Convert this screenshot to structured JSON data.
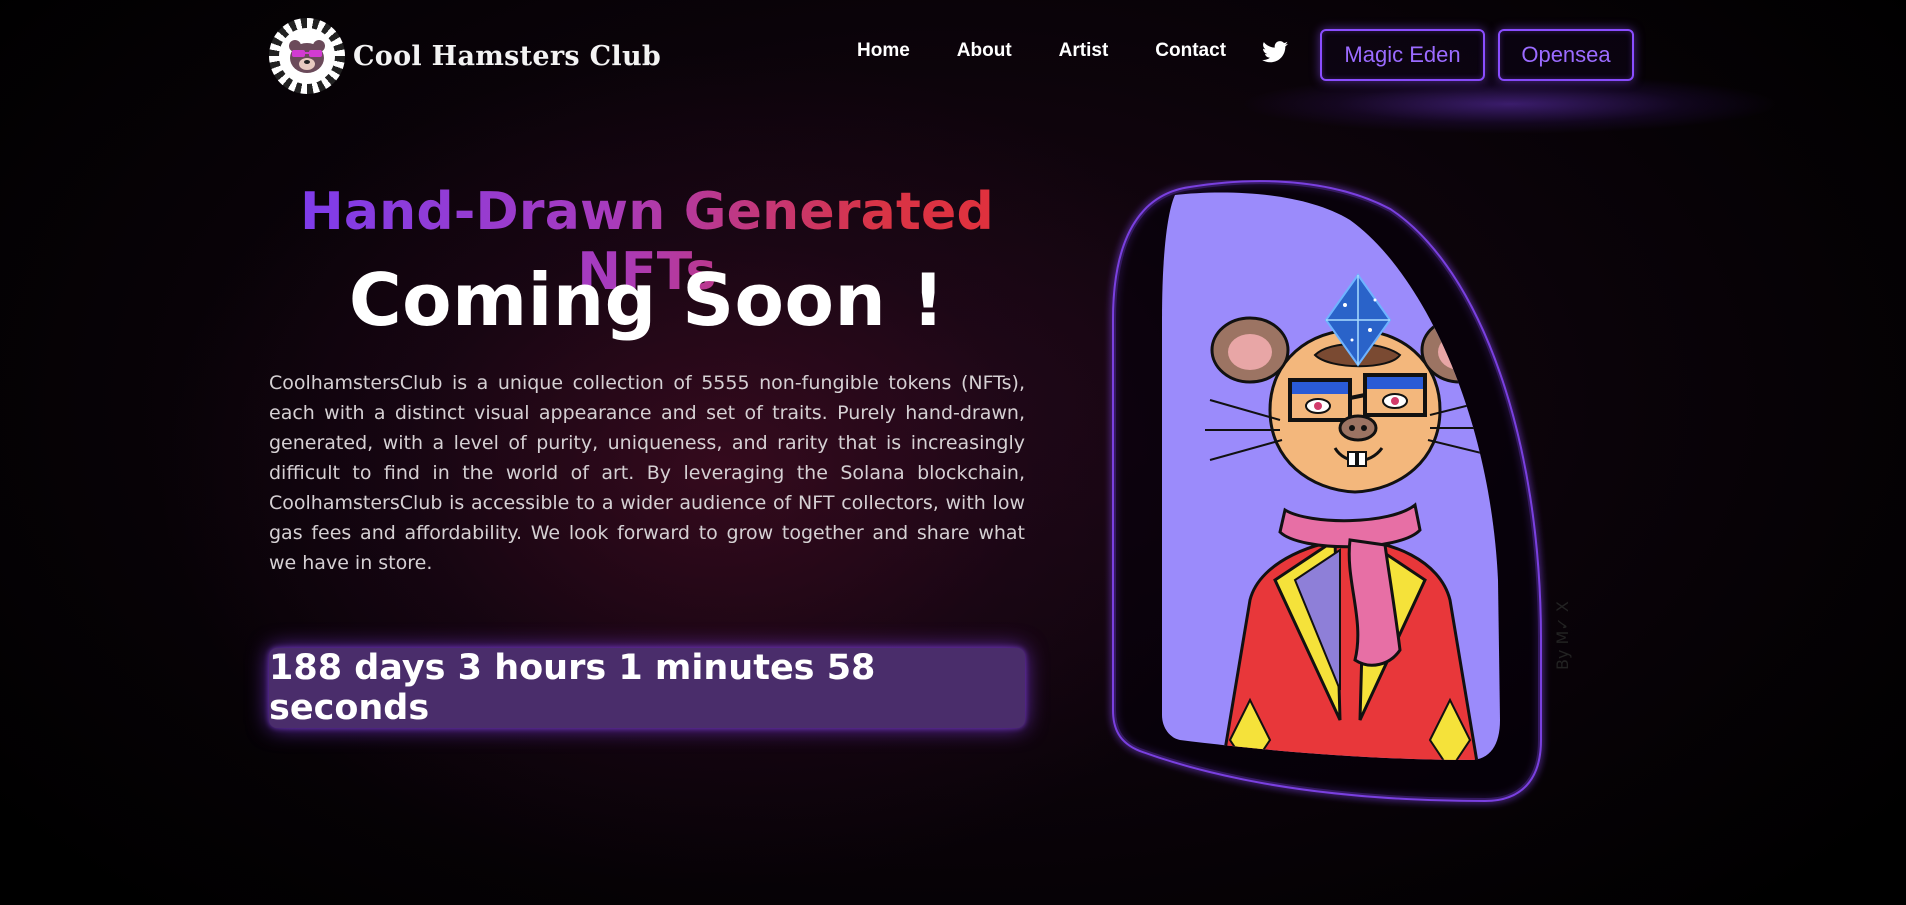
{
  "brand": {
    "name": "Cool Hamsters Club"
  },
  "nav": {
    "links": [
      {
        "label": "Home"
      },
      {
        "label": "About"
      },
      {
        "label": "Artist"
      },
      {
        "label": "Contact"
      }
    ],
    "social_icon": "twitter-icon",
    "buttons": {
      "magic_eden": "Magic Eden",
      "opensea": "Opensea"
    }
  },
  "hero": {
    "headline": "Hand-Drawn Generated NFTs",
    "subheadline": "Coming Soon !",
    "description": "CoolhamstersClub is a unique collection of 5555 non-fungible tokens (NFTs), each with a distinct visual appearance and set of traits. Purely hand-drawn, generated, with a level of purity, uniqueness, and rarity that is increasingly difficult to find in the world of art. By leveraging the Solana blockchain, CoolhamstersClub is accessible to a wider audience of NFT collectors, with low gas fees and affordability. We look forward to grow together and share what we have in store.",
    "countdown": "188 days 3 hours 1 minutes 58 seconds",
    "artwork_signature": "By M✓ X"
  },
  "colors": {
    "accent_purple": "#8a4dff",
    "countdown_bg": "#4a2d6b",
    "headline_start": "#7a3cf0",
    "headline_end": "#e2303a",
    "art_background": "#9b8bfb"
  }
}
